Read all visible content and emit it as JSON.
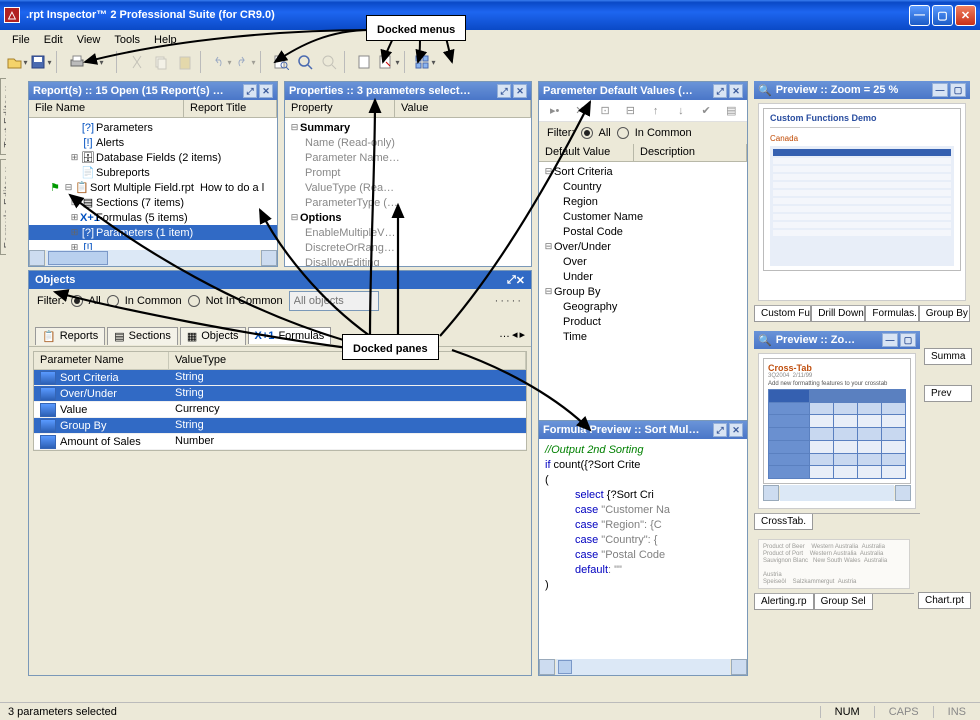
{
  "window": {
    "title": ".rpt Inspector™ 2 Professional Suite (for CR9.0)"
  },
  "menus": {
    "file": "File",
    "edit": "Edit",
    "view": "View",
    "tools": "Tools",
    "help": "Help"
  },
  "callouts": {
    "docked_menus": "Docked menus",
    "docked_panes": "Docked panes"
  },
  "side_tabs": {
    "text_editor": "Text Editor ::",
    "formula_editor": "Formula Editor ::"
  },
  "reports_pane": {
    "title": "Report(s) :: 15 Open  (15 Report(s) …",
    "cols": {
      "file": "File Name",
      "title": "Report Title"
    },
    "items": {
      "parameters": "Parameters",
      "alerts": "Alerts",
      "db": "Database Fields (2 items)",
      "subreports": "Subreports",
      "sortfile": "Sort Multiple Field.rpt",
      "sorttitle": "How to do a l",
      "sections": "Sections (7 items)",
      "formulas": "Formulas (5 items)",
      "params_sel": "Parameters (1 item)"
    }
  },
  "properties_pane": {
    "title": "Properties :: 3 parameters select…",
    "cols": {
      "prop": "Property",
      "val": "Value"
    },
    "groups": {
      "summary": "Summary",
      "options": "Options"
    },
    "rows": {
      "name": "Name (Read-only)",
      "paramname": "Parameter Name…",
      "prompt": "Prompt",
      "valtype": "ValueType (Rea…",
      "paramtype": "ParameterType (…",
      "enablemv": "EnableMultipleV…",
      "discrete": "DiscreteOrRang…",
      "disallow": "DisallowEditing"
    }
  },
  "defaults_pane": {
    "title": "Paremeter Default Values (…",
    "filter": {
      "label": "Filter:",
      "all": "All",
      "incommon": "In Common"
    },
    "cols": {
      "def": "Default Value",
      "desc": "Description"
    },
    "groups": {
      "sortcrit": "Sort Criteria",
      "overunder": "Over/Under",
      "groupby": "Group By"
    },
    "vals": {
      "country": "Country",
      "region": "Region",
      "custname": "Customer Name",
      "postal": "Postal Code",
      "over": "Over",
      "under": "Under",
      "geography": "Geography",
      "product": "Product",
      "time": "Time"
    }
  },
  "objects_pane": {
    "title": "Objects",
    "filter": {
      "label": "Filter:",
      "all": "All",
      "incommon": "In Common",
      "notincommon": "Not In Common"
    },
    "combo_placeholder": "All objects",
    "tabs": {
      "reports": "Reports",
      "sections": "Sections",
      "objects": "Objects",
      "formulas": "Formulas"
    },
    "more_symbol": "…",
    "gridcols": {
      "name": "Parameter Name",
      "type": "ValueType"
    },
    "rows": [
      {
        "name": "Sort Criteria",
        "type": "String",
        "sel": true
      },
      {
        "name": "Over/Under",
        "type": "String",
        "sel": true
      },
      {
        "name": "Value",
        "type": "Currency",
        "sel": false
      },
      {
        "name": "Group By",
        "type": "String",
        "sel": true
      },
      {
        "name": "Amount of Sales",
        "type": "Number",
        "sel": false
      }
    ]
  },
  "formula_pane": {
    "title": "Formula Preview :: Sort Mul…",
    "code": {
      "l1": "//Output 2nd Sorting",
      "l2a": "if",
      "l2b": " count({?Sort Crite",
      "l3": "(",
      "l4a": "select",
      "l4b": " {?Sort Cri",
      "l5a": "case",
      "l5b": " \"Customer Na",
      "l6a": "case",
      "l6b": " \"Region\": {C",
      "l7a": "case",
      "l7b": " \"Country\": {",
      "l8a": "case",
      "l8b": " \"Postal Code",
      "l9a": "default",
      "l9b": ": \"\"",
      "l10": ")"
    }
  },
  "preview1": {
    "title": "Preview :: Zoom = 25 %",
    "doc_title": "Custom Functions Demo",
    "doc_sub": "Canada",
    "tabs": {
      "a": "Custom Fu",
      "b": "Drill Down",
      "c": "Formulas.",
      "d": "Group By"
    }
  },
  "preview2": {
    "title": "Preview :: Zo…",
    "doc_title": "Cross-Tab",
    "tab": "CrossTab.",
    "side_tabs": {
      "summa": "Summa",
      "prev": "Prev"
    }
  },
  "preview3": {
    "tabs": {
      "a": "Alerting.rp",
      "b": "Group Sel"
    },
    "tab_right": "Chart.rpt"
  },
  "status": {
    "msg": "3 parameters selected",
    "num": "NUM",
    "caps": "CAPS",
    "ins": "INS"
  }
}
